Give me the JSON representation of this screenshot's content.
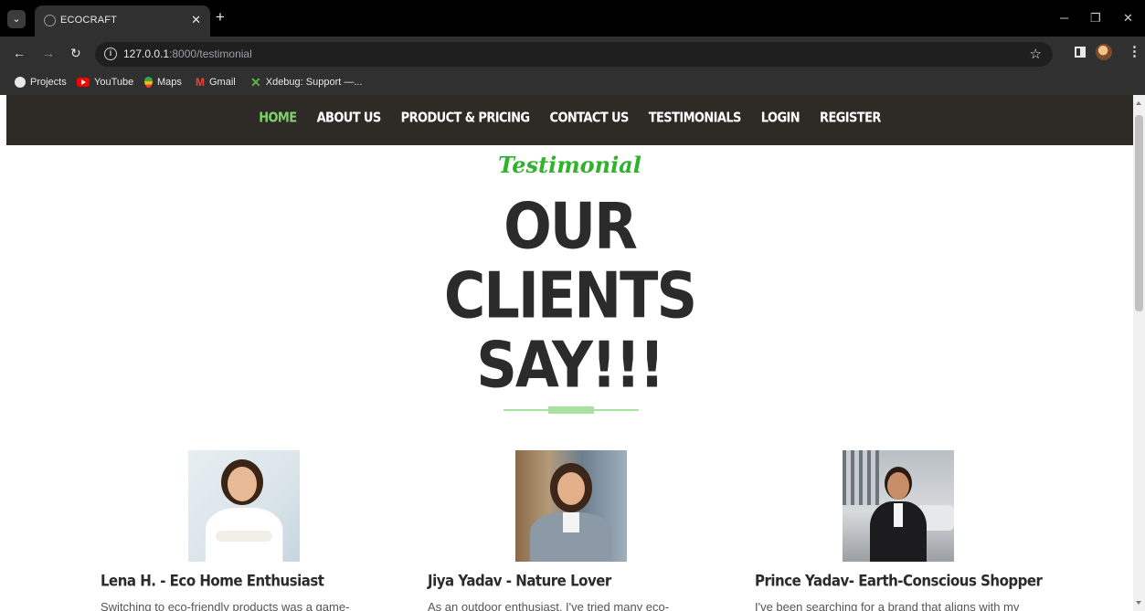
{
  "browser": {
    "tab_title": "ECOCRAFT",
    "url_host": "127.0.0.1",
    "url_path": ":8000/testimonial",
    "bookmarks": [
      {
        "label": "Projects",
        "icon": "globe-icon"
      },
      {
        "label": "YouTube",
        "icon": "youtube-icon"
      },
      {
        "label": "Maps",
        "icon": "maps-icon"
      },
      {
        "label": "Gmail",
        "icon": "gmail-icon"
      },
      {
        "label": "Xdebug: Support —...",
        "icon": "xdebug-icon"
      }
    ]
  },
  "nav": {
    "items": [
      {
        "label": "HOME",
        "active": true
      },
      {
        "label": "ABOUT US",
        "active": false
      },
      {
        "label": "PRODUCT & PRICING",
        "active": false
      },
      {
        "label": "CONTACT US",
        "active": false
      },
      {
        "label": "TESTIMONIALS",
        "active": false
      },
      {
        "label": "LOGIN",
        "active": false
      },
      {
        "label": "REGISTER",
        "active": false
      }
    ]
  },
  "hero": {
    "eyebrow": "Testimonial",
    "headline_lines": [
      "OUR",
      "CLIENTS",
      "SAY!!!"
    ]
  },
  "testimonials": [
    {
      "name": "Lena H. - Eco Home Enthusiast",
      "text": "Switching to eco-friendly products was a game-"
    },
    {
      "name": "Jiya Yadav - Nature Lover",
      "text": "As an outdoor enthusiast, I've tried many eco-"
    },
    {
      "name": "Prince Yadav- Earth-Conscious Shopper",
      "text": "I've been searching for a brand that aligns with my"
    }
  ],
  "colors": {
    "nav_bg": "#2e2a26",
    "nav_active": "#7ed36b",
    "eyebrow": "#2fb32a",
    "headline": "#2b2b2b",
    "divider": "#a8e2a0"
  }
}
